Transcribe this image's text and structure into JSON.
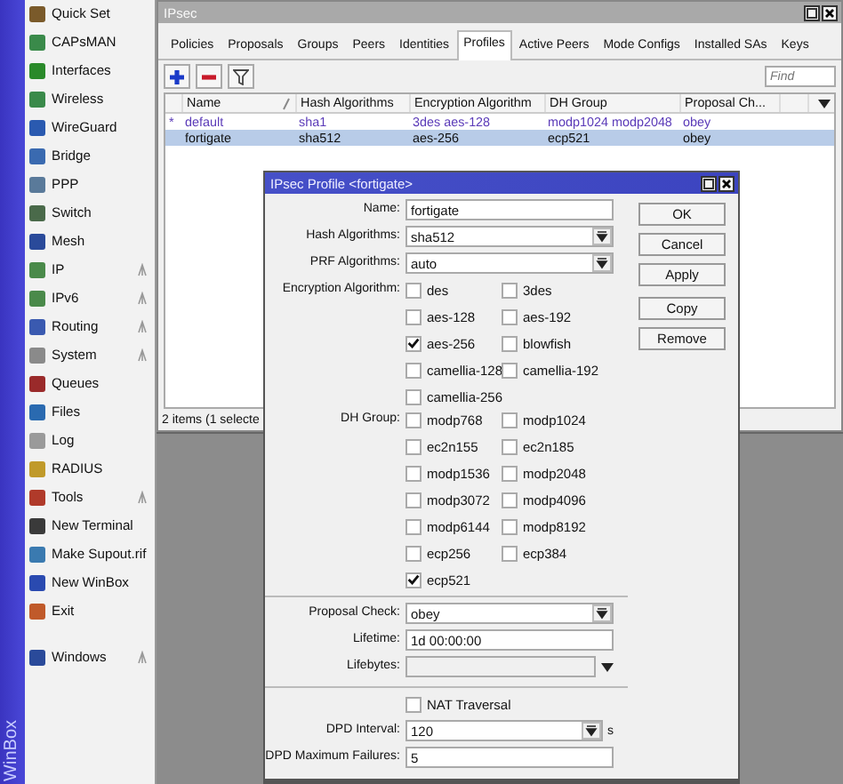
{
  "sidebar": {
    "brand": "WinBox",
    "items": [
      {
        "label": "Quick Set",
        "submenu": false
      },
      {
        "label": "CAPsMAN",
        "submenu": false
      },
      {
        "label": "Interfaces",
        "submenu": false
      },
      {
        "label": "Wireless",
        "submenu": false
      },
      {
        "label": "WireGuard",
        "submenu": false
      },
      {
        "label": "Bridge",
        "submenu": false
      },
      {
        "label": "PPP",
        "submenu": false
      },
      {
        "label": "Switch",
        "submenu": false
      },
      {
        "label": "Mesh",
        "submenu": false
      },
      {
        "label": "IP",
        "submenu": true
      },
      {
        "label": "IPv6",
        "submenu": true
      },
      {
        "label": "Routing",
        "submenu": true
      },
      {
        "label": "System",
        "submenu": true
      },
      {
        "label": "Queues",
        "submenu": false
      },
      {
        "label": "Files",
        "submenu": false
      },
      {
        "label": "Log",
        "submenu": false
      },
      {
        "label": "RADIUS",
        "submenu": false
      },
      {
        "label": "Tools",
        "submenu": true
      },
      {
        "label": "New Terminal",
        "submenu": false
      },
      {
        "label": "Make Supout.rif",
        "submenu": false
      },
      {
        "label": "New WinBox",
        "submenu": false
      },
      {
        "label": "Exit",
        "submenu": false
      }
    ],
    "bottom_items": [
      {
        "label": "Windows",
        "submenu": true
      }
    ]
  },
  "window": {
    "title": "IPsec",
    "tabs": [
      {
        "label": "Policies",
        "selected": false
      },
      {
        "label": "Proposals",
        "selected": false
      },
      {
        "label": "Groups",
        "selected": false
      },
      {
        "label": "Peers",
        "selected": false
      },
      {
        "label": "Identities",
        "selected": false
      },
      {
        "label": "Profiles",
        "selected": true
      },
      {
        "label": "Active Peers",
        "selected": false
      },
      {
        "label": "Mode Configs",
        "selected": false
      },
      {
        "label": "Installed SAs",
        "selected": false
      },
      {
        "label": "Keys",
        "selected": false
      }
    ],
    "find": {
      "placeholder": "Find"
    },
    "table": {
      "columns": [
        "Name",
        "Hash Algorithms",
        "Encryption Algorithm",
        "DH Group",
        "Proposal Ch..."
      ],
      "rows": [
        {
          "flag": "*",
          "default": true,
          "selected": false,
          "cells": [
            "default",
            "sha1",
            "3des aes-128",
            "modp1024 modp2048",
            "obey"
          ]
        },
        {
          "flag": "",
          "default": false,
          "selected": true,
          "cells": [
            "fortigate",
            "sha512",
            "aes-256",
            "ecp521",
            "obey"
          ]
        }
      ]
    },
    "status_bar": "2 items (1 selecte"
  },
  "dialog": {
    "title": "IPsec Profile <fortigate>",
    "sections": [
      {
        "fields": [
          {
            "kind": "text",
            "label": "Name:",
            "value": "fortigate"
          },
          {
            "kind": "select",
            "label": "Hash Algorithms:",
            "value": "sha512"
          },
          {
            "kind": "select",
            "label": "PRF Algorithms:",
            "value": "auto"
          },
          {
            "kind": "checks",
            "label": "Encryption Algorithm:",
            "options": [
              {
                "label": "des",
                "checked": false
              },
              {
                "label": "3des",
                "checked": false
              },
              {
                "label": "aes-128",
                "checked": false
              },
              {
                "label": "aes-192",
                "checked": false
              },
              {
                "label": "aes-256",
                "checked": true
              },
              {
                "label": "blowfish",
                "checked": false
              },
              {
                "label": "camellia-128",
                "checked": false
              },
              {
                "label": "camellia-192",
                "checked": false
              },
              {
                "label": "camellia-256",
                "checked": false
              }
            ]
          },
          {
            "kind": "checks",
            "label": "DH Group:",
            "options": [
              {
                "label": "modp768",
                "checked": false
              },
              {
                "label": "modp1024",
                "checked": false
              },
              {
                "label": "ec2n155",
                "checked": false
              },
              {
                "label": "ec2n185",
                "checked": false
              },
              {
                "label": "modp1536",
                "checked": false
              },
              {
                "label": "modp2048",
                "checked": false
              },
              {
                "label": "modp3072",
                "checked": false
              },
              {
                "label": "modp4096",
                "checked": false
              },
              {
                "label": "modp6144",
                "checked": false
              },
              {
                "label": "modp8192",
                "checked": false
              },
              {
                "label": "ecp256",
                "checked": false
              },
              {
                "label": "ecp384",
                "checked": false
              },
              {
                "label": "ecp521",
                "checked": true
              }
            ]
          }
        ]
      },
      {
        "fields": [
          {
            "kind": "select",
            "label": "Proposal Check:",
            "value": "obey"
          },
          {
            "kind": "text",
            "label": "Lifetime:",
            "value": "1d 00:00:00"
          },
          {
            "kind": "expand",
            "label": "Lifebytes:"
          }
        ]
      },
      {
        "fields": [
          {
            "kind": "checkbox",
            "label": "NAT Traversal",
            "checked": false
          },
          {
            "kind": "select",
            "label": "DPD Interval:",
            "value": "120",
            "unit": "s"
          },
          {
            "kind": "text",
            "label": "DPD Maximum Failures:",
            "value": "5"
          }
        ]
      }
    ],
    "button_groups": [
      [
        "OK",
        "Cancel",
        "Apply"
      ],
      [
        "Copy",
        "Remove"
      ]
    ]
  }
}
